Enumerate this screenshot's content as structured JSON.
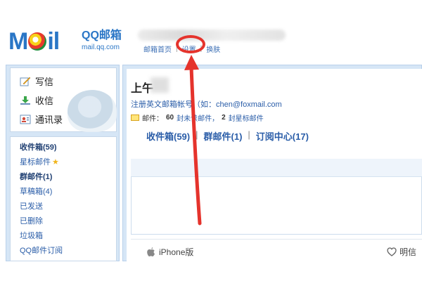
{
  "header": {
    "brand_name": "QQ邮箱",
    "brand_url": "mail.qq.com",
    "links": [
      "邮箱首页",
      "设置",
      "换肤"
    ]
  },
  "sidebar": {
    "actions": [
      {
        "label": "写信",
        "icon": "compose-icon"
      },
      {
        "label": "收信",
        "icon": "inbox-download-icon"
      },
      {
        "label": "通讯录",
        "icon": "contacts-icon"
      }
    ],
    "folders": [
      {
        "label": "收件箱(59)",
        "bold": true
      },
      {
        "label": "星标邮件",
        "star": true
      },
      {
        "label": "群邮件(1)",
        "bold": true
      },
      {
        "label": "草稿箱(4)"
      },
      {
        "label": "已发送"
      },
      {
        "label": "已删除"
      },
      {
        "label": "垃圾箱"
      },
      {
        "label": "QQ邮件订阅"
      }
    ]
  },
  "main": {
    "greeting": "上午",
    "register_line": "注册英文邮箱帐号（如：chen@foxmail.com",
    "stats": {
      "prefix": "邮件：",
      "unread_count": "60",
      "unread_text": "封未读邮件，",
      "starred_count": "2",
      "starred_text": "封星标邮件"
    },
    "quick_links": [
      "收件箱(59)",
      "群邮件(1)",
      "订阅中心(17)"
    ],
    "bottom_links": {
      "iphone": "iPhone版",
      "postcard": "明信"
    }
  },
  "colors": {
    "brand_blue": "#2a76c6",
    "link_blue": "#2a5da8",
    "annotation_red": "#e5332c",
    "frame_blue": "#d6e6f6"
  }
}
